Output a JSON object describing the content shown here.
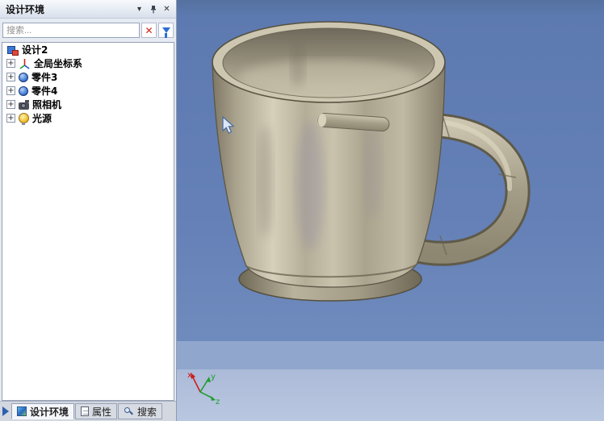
{
  "panel": {
    "title": "设计环境",
    "search": {
      "placeholder": "搜索..."
    },
    "tree": {
      "root": {
        "label": "设计2"
      },
      "items": [
        {
          "label": "全局坐标系",
          "icon": "coordinate-system-icon"
        },
        {
          "label": "零件3",
          "icon": "part-icon"
        },
        {
          "label": "零件4",
          "icon": "part-icon"
        },
        {
          "label": "照相机",
          "icon": "camera-icon"
        },
        {
          "label": "光源",
          "icon": "light-icon"
        }
      ]
    },
    "tabs": [
      {
        "label": "设计环境"
      },
      {
        "label": "属性"
      },
      {
        "label": "搜索"
      }
    ]
  },
  "icons": {
    "dropdown": "▾",
    "close": "✕",
    "clear_search": "✕",
    "expand_plus": "+"
  },
  "viewport": {
    "axis_labels": {
      "x": "x",
      "y": "y",
      "z": "z"
    }
  },
  "colors": {
    "viewport_sky_top": "#5d7ab0",
    "viewport_sky_bottom": "#bac7e1",
    "mug_body": "#b9b29b",
    "mug_shadow": "#6e695b",
    "accent_red": "#d42215",
    "panel_bg": "#e6eaf2"
  }
}
